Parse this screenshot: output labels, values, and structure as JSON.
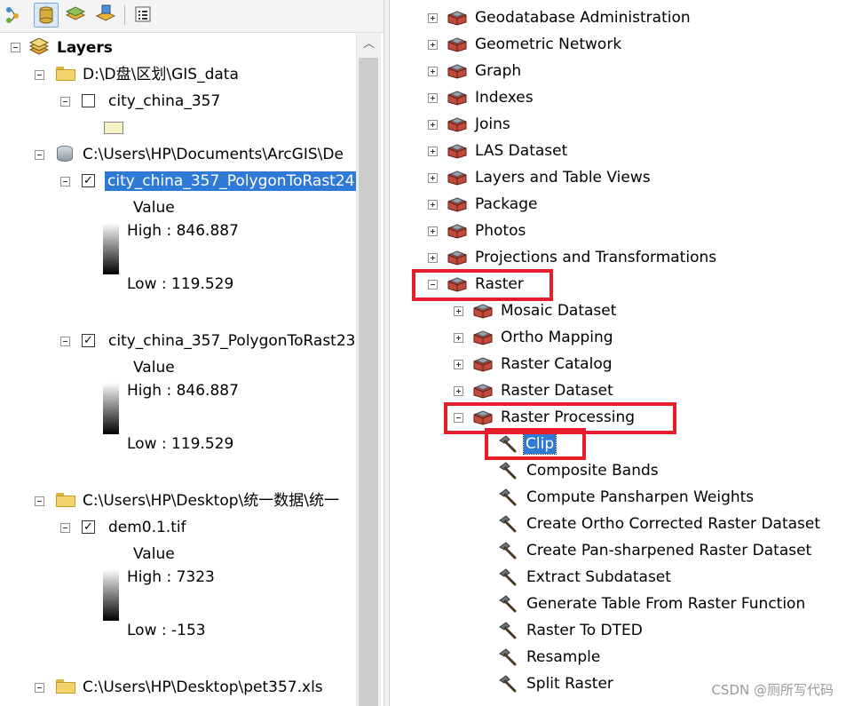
{
  "toc": {
    "toolbar": {
      "buttons": [
        {
          "icon": "list-by-drawing-order-icon"
        },
        {
          "icon": "list-by-source-icon",
          "active": true
        },
        {
          "icon": "list-by-visibility-icon"
        },
        {
          "icon": "list-by-selection-icon"
        },
        {
          "icon": "options-icon"
        }
      ]
    },
    "root_label": "Layers",
    "items": [
      {
        "type": "folder",
        "label": "D:\\D盘\\区划\\GIS_data"
      },
      {
        "type": "layer",
        "label": "city_china_357",
        "checked": false
      },
      {
        "type": "gdb",
        "label": "C:\\Users\\HP\\Documents\\ArcGIS\\De"
      },
      {
        "type": "layer",
        "label": "city_china_357_PolygonToRast24",
        "checked": true,
        "selected": true,
        "legend": {
          "title": "Value",
          "high": "High : 846.887",
          "low": "Low : 119.529"
        }
      },
      {
        "type": "layer",
        "label": "city_china_357_PolygonToRast23",
        "checked": true,
        "legend": {
          "title": "Value",
          "high": "High : 846.887",
          "low": "Low : 119.529"
        }
      },
      {
        "type": "folder",
        "label": "C:\\Users\\HP\\Desktop\\统一数据\\统一"
      },
      {
        "type": "layer",
        "label": "dem0.1.tif",
        "checked": true,
        "legend": {
          "title": "Value",
          "high": "High : 7323",
          "low": "Low : -153"
        }
      },
      {
        "type": "folder",
        "label": "C:\\Users\\HP\\Desktop\\pet357.xls"
      }
    ]
  },
  "toolbox": {
    "items": [
      {
        "label": "Geodatabase Administration",
        "expanded": false
      },
      {
        "label": "Geometric Network",
        "expanded": false
      },
      {
        "label": "Graph",
        "expanded": false
      },
      {
        "label": "Indexes",
        "expanded": false
      },
      {
        "label": "Joins",
        "expanded": false
      },
      {
        "label": "LAS Dataset",
        "expanded": false
      },
      {
        "label": "Layers and Table Views",
        "expanded": false
      },
      {
        "label": "Package",
        "expanded": false
      },
      {
        "label": "Photos",
        "expanded": false
      },
      {
        "label": "Projections and Transformations",
        "expanded": false
      },
      {
        "label": "Raster",
        "expanded": true
      }
    ],
    "raster_children": [
      {
        "label": "Mosaic Dataset",
        "expanded": false
      },
      {
        "label": "Ortho Mapping",
        "expanded": false
      },
      {
        "label": "Raster Catalog",
        "expanded": false
      },
      {
        "label": "Raster Dataset",
        "expanded": false
      },
      {
        "label": "Raster Processing",
        "expanded": true
      }
    ],
    "raster_processing_tools": [
      {
        "label": "Clip",
        "selected": true
      },
      {
        "label": "Composite Bands"
      },
      {
        "label": "Compute Pansharpen Weights"
      },
      {
        "label": "Create Ortho Corrected Raster Dataset"
      },
      {
        "label": "Create Pan-sharpened Raster Dataset"
      },
      {
        "label": "Extract Subdataset"
      },
      {
        "label": "Generate Table From Raster Function"
      },
      {
        "label": "Raster To DTED"
      },
      {
        "label": "Resample"
      },
      {
        "label": "Split Raster"
      }
    ]
  },
  "colors": {
    "highlight": "#2f7ad6",
    "annotation": "#e61e2a"
  },
  "watermark": "CSDN @厕所写代码"
}
